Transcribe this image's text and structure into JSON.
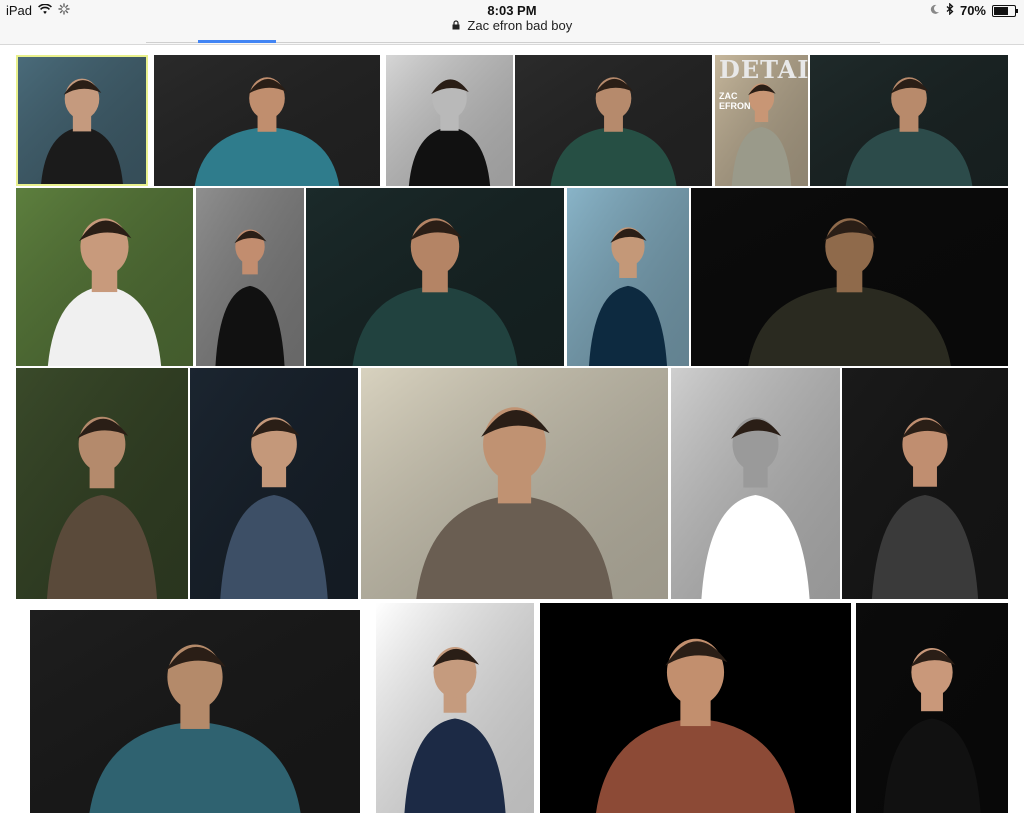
{
  "status_bar": {
    "device": "iPad",
    "time": "8:03 PM",
    "battery_percent": "70%",
    "battery_level": 0.7
  },
  "url_bar": {
    "title": "Zac efron bad boy"
  },
  "image_results": [
    {
      "id": "r1",
      "bg": "#4a6b7a",
      "fg": "#1b1b1b",
      "skin": "#c59a7e"
    },
    {
      "id": "r2",
      "bg": "#2a2a2a",
      "fg": "#2f7c8c",
      "skin": "#c08e6e"
    },
    {
      "id": "r3",
      "bg": "#d6d6d6",
      "fg": "#111111",
      "skin": "#b9b9b9"
    },
    {
      "id": "r4",
      "bg": "#2b2b2b",
      "fg": "#264f44",
      "skin": "#b68a6c"
    },
    {
      "id": "r5",
      "bg": "#c6b79c",
      "fg": "#9a9a8a",
      "skin": "#c89675",
      "overlay": "DETAILS",
      "overlay_sub": "ZAC\nEFRON"
    },
    {
      "id": "r6",
      "bg": "#1f2a2a",
      "fg": "#2c4b4a",
      "skin": "#b88a6b"
    },
    {
      "id": "r7",
      "bg": "#5d7f3e",
      "fg": "#f0f0f0",
      "skin": "#c89a7c"
    },
    {
      "id": "r8",
      "bg": "#8f8f8f",
      "fg": "#111111",
      "skin": "#c28d6f"
    },
    {
      "id": "r9",
      "bg": "#1b2a2a",
      "fg": "#21423f",
      "skin": "#b48465"
    },
    {
      "id": "r10",
      "bg": "#89b4c8",
      "fg": "#0d2a40",
      "skin": "#c49878"
    },
    {
      "id": "r11",
      "bg": "#0c0c0c",
      "fg": "#2a2a20",
      "skin": "#8f6a4b"
    },
    {
      "id": "r12",
      "bg": "#3a4a2a",
      "fg": "#5a4a3a",
      "skin": "#b48a6c"
    },
    {
      "id": "r13",
      "bg": "#1b2530",
      "fg": "#3d4f66",
      "skin": "#c4987a"
    },
    {
      "id": "r14",
      "bg": "#d8d2bf",
      "fg": "#6a5e52",
      "skin": "#c09272"
    },
    {
      "id": "r15",
      "bg": "#cfcfcf",
      "fg": "#ffffff",
      "skin": "#9a9a9a"
    },
    {
      "id": "r16",
      "bg": "#1a1a1a",
      "fg": "#3a3a3a",
      "skin": "#c08e70"
    },
    {
      "id": "r17",
      "bg": "#1e1e1e",
      "fg": "#2f6270",
      "skin": "#b48a6a"
    },
    {
      "id": "r18",
      "bg": "#ffffff",
      "fg": "#1c2a45",
      "skin": "#c59b7e"
    },
    {
      "id": "r19",
      "bg": "#000000",
      "fg": "#8c4a36",
      "skin": "#c28f6e"
    },
    {
      "id": "r20",
      "bg": "#0b0b0b",
      "fg": "#111111",
      "skin": "#c9987a"
    }
  ]
}
